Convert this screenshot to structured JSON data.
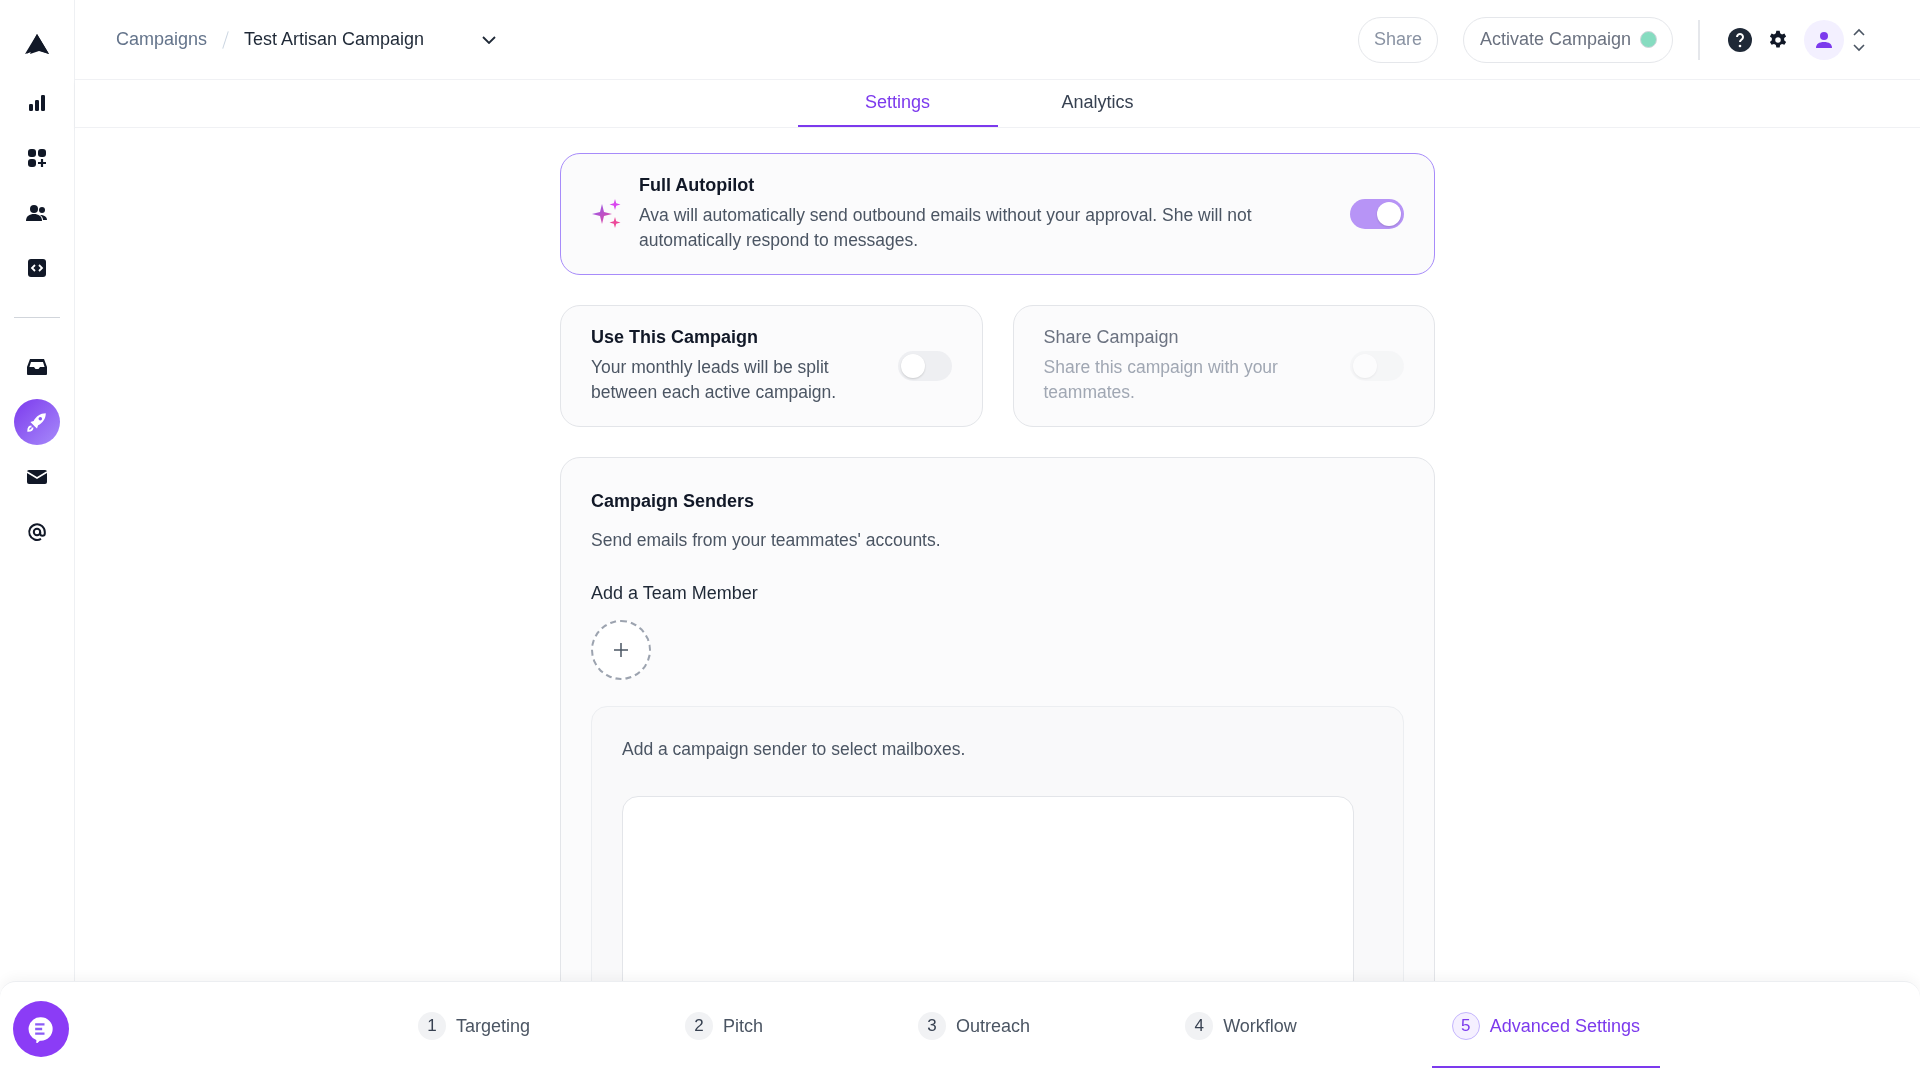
{
  "sidebar": {
    "items": [
      {
        "kind": "chart",
        "selected": false
      },
      {
        "kind": "apps",
        "selected": false
      },
      {
        "kind": "people",
        "selected": false
      },
      {
        "kind": "code",
        "selected": false
      }
    ],
    "bottom_items": [
      {
        "kind": "inbox",
        "selected": false
      },
      {
        "kind": "rocket",
        "selected": true
      },
      {
        "kind": "mail",
        "selected": false
      },
      {
        "kind": "at",
        "selected": false
      }
    ]
  },
  "breadcrumb": [
    "Campaigns",
    "Test Artisan Campaign"
  ],
  "header": {
    "share": "Share",
    "activate": "Activate Campaign"
  },
  "tabs": [
    {
      "label": "Settings",
      "selected": true
    },
    {
      "label": "Analytics",
      "selected": false
    }
  ],
  "autopilot": {
    "title": "Full Autopilot",
    "description": "Ava will automatically send outbound emails without your approval. She will not automatically respond to messages.",
    "on": true
  },
  "cards": [
    {
      "title": "Use This Campaign",
      "description": "Your monthly leads will be split between each active campaign.",
      "on": false,
      "disabled": false
    },
    {
      "title": "Share Campaign",
      "description": "Share this campaign with your teammates.",
      "on": false,
      "disabled": true
    }
  ],
  "senders": {
    "title": "Campaign Senders",
    "subtitle": "Send emails from your teammates' accounts.",
    "add_label": "Add a Team Member",
    "mailbox_hint": "Add a campaign sender to select mailboxes."
  },
  "steps": [
    {
      "number": "1",
      "label": "Targeting",
      "selected": false
    },
    {
      "number": "2",
      "label": "Pitch",
      "selected": false
    },
    {
      "number": "3",
      "label": "Outreach",
      "selected": false
    },
    {
      "number": "4",
      "label": "Workflow",
      "selected": false
    },
    {
      "number": "5",
      "label": "Advanced Settings",
      "selected": true
    }
  ]
}
